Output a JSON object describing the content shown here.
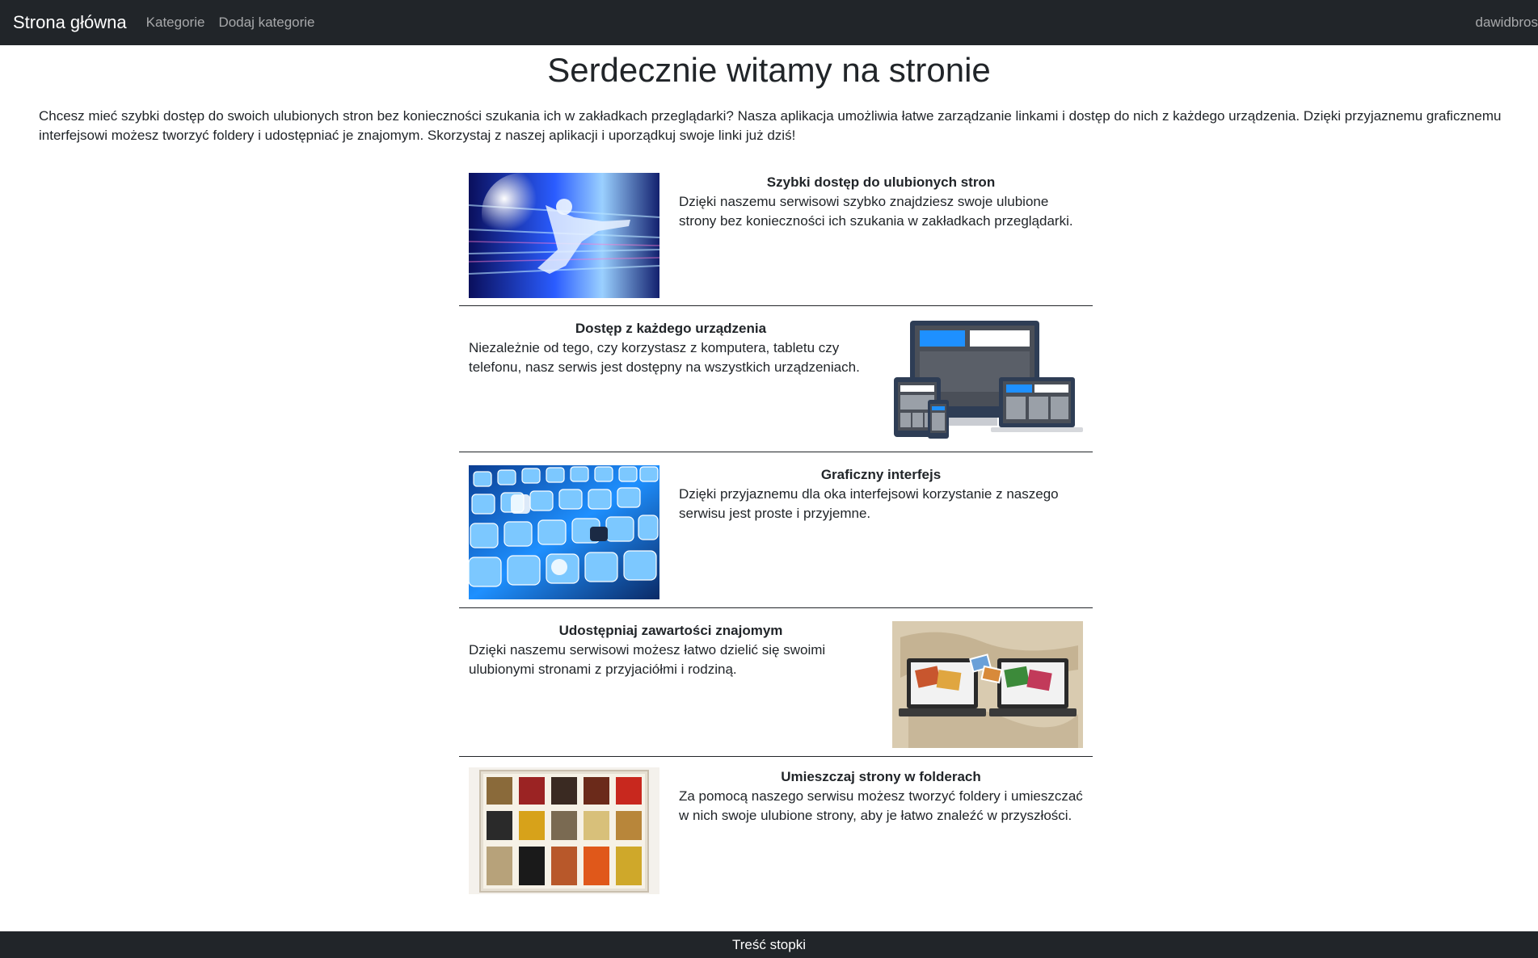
{
  "navbar": {
    "brand": "Strona główna",
    "links": [
      "Kategorie",
      "Dodaj kategorie"
    ],
    "user": "dawidbros"
  },
  "page": {
    "title": "Serdecznie witamy na stronie",
    "intro": "Chcesz mieć szybki dostęp do swoich ulubionych stron bez konieczności szukania ich w zakładkach przeglądarki? Nasza aplikacja umożliwia łatwe zarządzanie linkami i dostęp do nich z każdego urządzenia. Dzięki przyjaznemu graficznemu interfejsowi możesz tworzyć foldery i udostępniać je znajomym. Skorzystaj z naszej aplikacji i uporządkuj swoje linki już dziś!"
  },
  "features": [
    {
      "title": "Szybki dostęp do ulubionych stron",
      "text": "Dzięki naszemu serwisowi szybko znajdziesz swoje ulubione strony bez konieczności ich szukania w zakładkach przeglądarki.",
      "image": "speed-runner-image"
    },
    {
      "title": "Dostęp z każdego urządzenia",
      "text": "Niezależnie od tego, czy korzystasz z komputera, tabletu czy telefonu, nasz serwis jest dostępny na wszystkich urządzeniach.",
      "image": "responsive-devices-image"
    },
    {
      "title": "Graficzny interfejs",
      "text": "Dzięki przyjaznemu dla oka interfejsowi korzystanie z naszego serwisu jest proste i przyjemne.",
      "image": "app-icons-image"
    },
    {
      "title": "Udostępniaj zawartości znajomym",
      "text": "Dzięki naszemu serwisowi możesz łatwo dzielić się swoimi ulubionymi stronami z przyjaciółmi i rodziną.",
      "image": "sharing-laptops-image"
    },
    {
      "title": "Umieszczaj strony w folderach",
      "text": "Za pomocą naszego serwisu możesz tworzyć foldery i umieszczać w nich swoje ulubione strony, aby je łatwo znaleźć w przyszłości.",
      "image": "spice-box-image"
    }
  ],
  "footer": {
    "text": "Treść stopki"
  }
}
